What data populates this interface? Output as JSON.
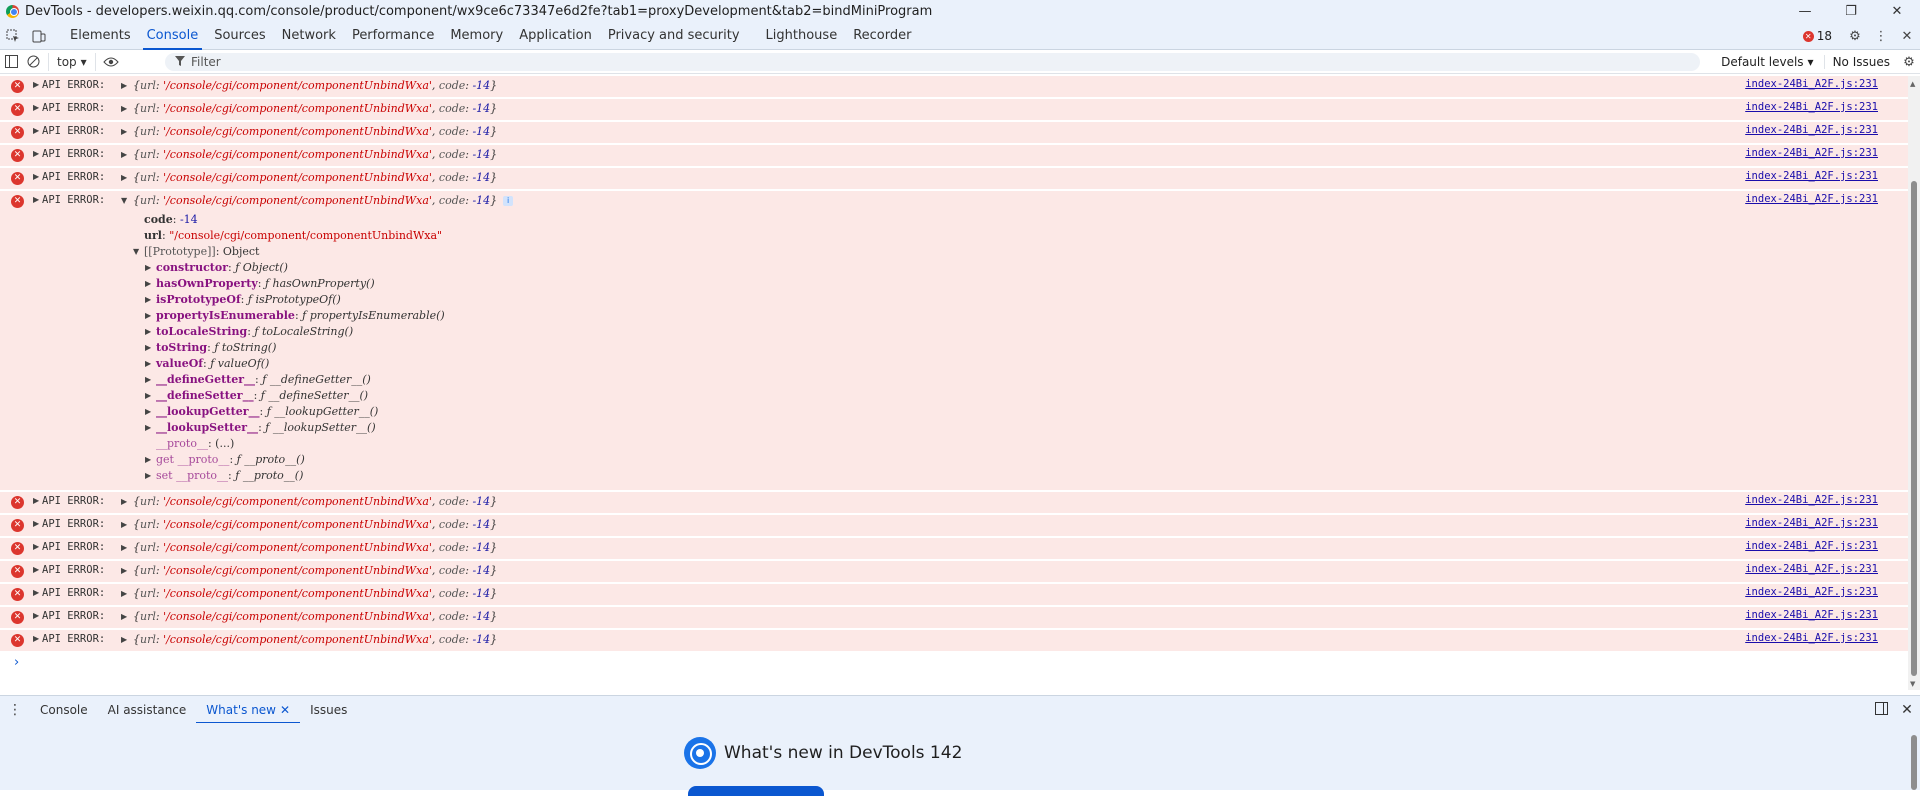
{
  "window": {
    "title": "DevTools - developers.weixin.qq.com/console/product/component/wx9ce6c73347e6d2fe?tab1=proxyDevelopment&tab2=bindMiniProgram",
    "controls": [
      "—",
      "❐",
      "✕"
    ]
  },
  "tabs": [
    {
      "label": "Elements",
      "active": false
    },
    {
      "label": "Console",
      "active": true
    },
    {
      "label": "Sources",
      "active": false
    },
    {
      "label": "Network",
      "active": false
    },
    {
      "label": "Performance",
      "active": false
    },
    {
      "label": "Memory",
      "active": false
    },
    {
      "label": "Application",
      "active": false
    },
    {
      "label": "Privacy and security",
      "active": false
    },
    {
      "label": "Lighthouse",
      "active": false
    },
    {
      "label": "Recorder",
      "active": false
    }
  ],
  "tabbar_right": {
    "error_count": "18"
  },
  "toolbar": {
    "context": "top",
    "filter_placeholder": "Filter",
    "levels": "Default levels",
    "issues": "No Issues"
  },
  "message_template": {
    "label": "API ERROR:",
    "url_key": "url",
    "url_value": "'/console/cgi/component/componentUnbindWxa'",
    "code_key": "code",
    "code_value": "-14",
    "source": "index-24Bi_A2F.js:231"
  },
  "messages_before": 5,
  "messages_after": 7,
  "expanded": {
    "code_line": {
      "key": "code",
      "value": "-14"
    },
    "url_line": {
      "key": "url",
      "value": "\"/console/cgi/component/componentUnbindWxa\""
    },
    "prototype_label": "[[Prototype]]",
    "prototype_value": "Object",
    "members": [
      {
        "key": "constructor",
        "value": "ƒ Object()"
      },
      {
        "key": "hasOwnProperty",
        "value": "ƒ hasOwnProperty()"
      },
      {
        "key": "isPrototypeOf",
        "value": "ƒ isPrototypeOf()"
      },
      {
        "key": "propertyIsEnumerable",
        "value": "ƒ propertyIsEnumerable()"
      },
      {
        "key": "toLocaleString",
        "value": "ƒ toLocaleString()"
      },
      {
        "key": "toString",
        "value": "ƒ toString()"
      },
      {
        "key": "valueOf",
        "value": "ƒ valueOf()"
      },
      {
        "key": "__defineGetter__",
        "value": "ƒ __defineGetter__()"
      },
      {
        "key": "__defineSetter__",
        "value": "ƒ __defineSetter__()"
      },
      {
        "key": "__lookupGetter__",
        "value": "ƒ __lookupGetter__()"
      },
      {
        "key": "__lookupSetter__",
        "value": "ƒ __lookupSetter__()"
      }
    ],
    "proto_line": {
      "key": "__proto__",
      "value": "(...)"
    },
    "getter": {
      "key": "get __proto__",
      "value": "ƒ __proto__()"
    },
    "setter": {
      "key": "set __proto__",
      "value": "ƒ __proto__()"
    }
  },
  "drawer": {
    "tabs": [
      {
        "label": "Console",
        "active": false
      },
      {
        "label": "AI assistance",
        "active": false
      },
      {
        "label": "What's new",
        "active": true,
        "closable": true
      },
      {
        "label": "Issues",
        "active": false
      }
    ],
    "whats_new_title": "What's new in DevTools 142"
  }
}
